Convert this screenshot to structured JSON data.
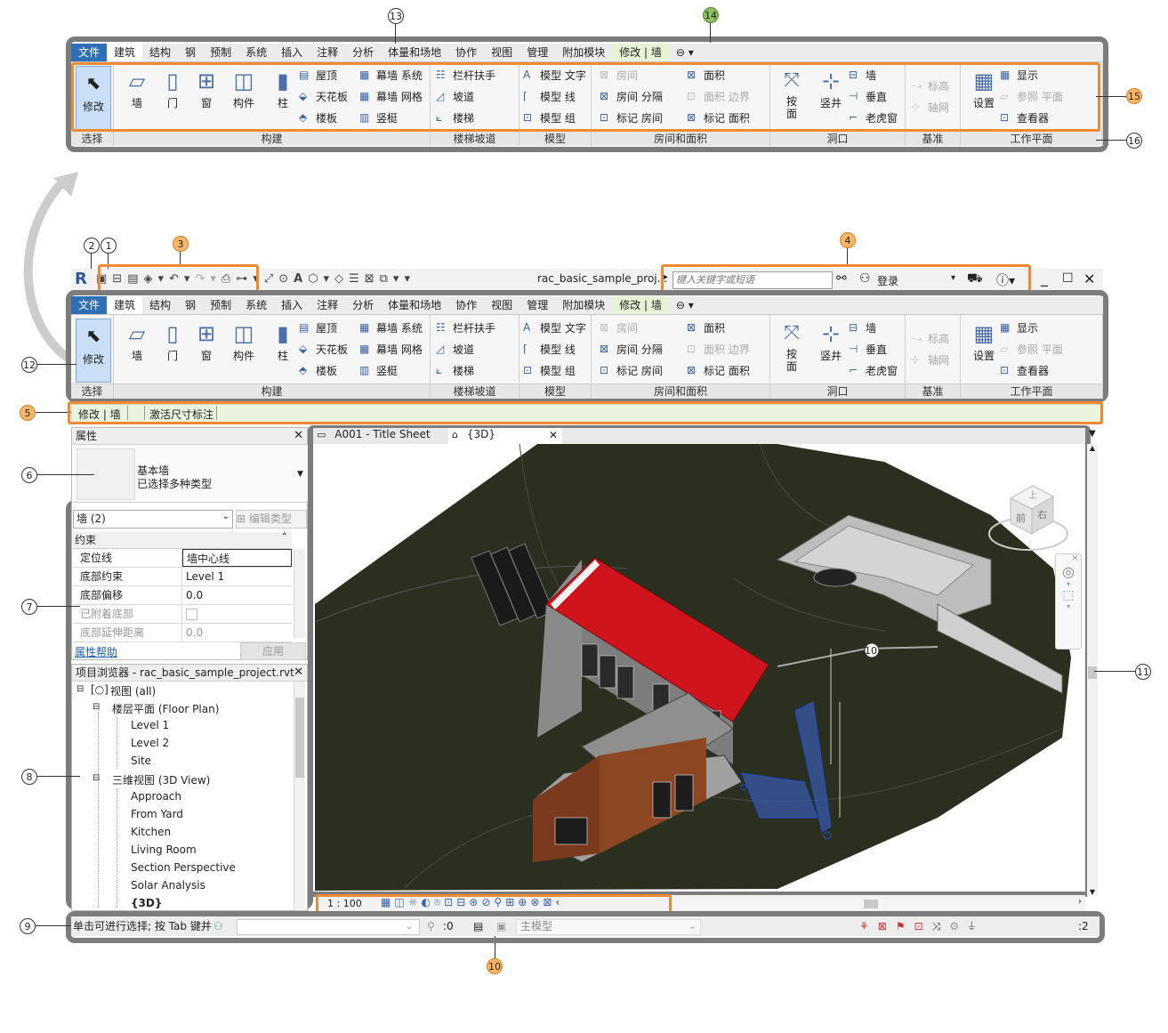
{
  "ribbon": {
    "tabs": [
      "文件",
      "建筑",
      "结构",
      "钢",
      "预制",
      "系统",
      "插入",
      "注释",
      "分析",
      "体量和场地",
      "协作",
      "视图",
      "管理",
      "附加模块",
      "修改 | 墙"
    ],
    "extra_tab_icon": "ribbon-toggle-icon",
    "modify_label": "修改",
    "select_label": "选择",
    "build": {
      "wall": "墙",
      "door": "门",
      "window": "窗",
      "component": "构件",
      "column": "柱",
      "roof": "屋顶",
      "ceiling": "天花板",
      "floor": "楼板",
      "curtain_system": "幕墙 系统",
      "curtain_grid": "幕墙 网格",
      "mullion": "竖梃",
      "label": "构建"
    },
    "stairs": {
      "railing": "栏杆扶手",
      "ramp": "坡道",
      "stair": "楼梯",
      "label": "楼梯坡道"
    },
    "model": {
      "text": "模型 文字",
      "line": "模型 线",
      "group": "模型 组",
      "label": "模型"
    },
    "room": {
      "room": "房间",
      "separator": "房间 分隔",
      "tag_room": "标记 房间",
      "area": "面积",
      "area_boundary": "面积 边界",
      "tag_area": "标记 面积",
      "label": "房间和面积"
    },
    "opening": {
      "by_face": "按面",
      "shaft": "竖井",
      "wall": "墙",
      "vertical": "垂直",
      "dormer": "老虎窗",
      "label": "洞口"
    },
    "datum": {
      "level": "标高",
      "grid": "轴网",
      "label": "基准"
    },
    "workplane": {
      "set": "设置",
      "show": "显示",
      "ref_plane": "参照 平面",
      "viewer": "查看器",
      "label": "工作平面"
    }
  },
  "titlebar": {
    "logo": "R",
    "filename": "rac_basic_sample_proj...",
    "search_placeholder": "键入关键字或短语",
    "login": "登录"
  },
  "options_bar": {
    "context": "修改 | 墙",
    "activate_dims": "激活尺寸标注"
  },
  "properties": {
    "title": "属性",
    "type_name": "基本墙",
    "type_sub": "已选择多种类型",
    "selector": "墙 (2)",
    "edit_type": "编辑类型",
    "section": "约束",
    "rows": [
      {
        "k": "定位线",
        "v": "墙中心线"
      },
      {
        "k": "底部约束",
        "v": "Level 1"
      },
      {
        "k": "底部偏移",
        "v": "0.0"
      },
      {
        "k": "已附着底部",
        "v": ""
      },
      {
        "k": "底部延伸距离",
        "v": "0.0"
      }
    ],
    "help": "属性帮助",
    "apply": "应用"
  },
  "browser": {
    "title": "项目浏览器 - rac_basic_sample_project.rvt",
    "views": "视图 (all)",
    "floor_plan": "楼层平面 (Floor Plan)",
    "plans": [
      "Level 1",
      "Level 2",
      "Site"
    ],
    "three_d": "三维视图 (3D View)",
    "views3d": [
      "Approach",
      "From Yard",
      "Kitchen",
      "Living Room",
      "Section Perspective",
      "Solar Analysis",
      "{3D}"
    ]
  },
  "view_tabs": {
    "sheet": "A001 - Title Sheet",
    "three_d": "{3D}"
  },
  "viewcube": {
    "front": "前",
    "right": "右",
    "top": "上"
  },
  "view_control": {
    "scale": "1 : 100"
  },
  "statusbar": {
    "message": "单击可进行选择; 按 Tab 键并",
    "worksets": ":0",
    "model": "主模型",
    "filter_count": ":2"
  },
  "callouts": [
    "1",
    "2",
    "3",
    "4",
    "5",
    "6",
    "7",
    "8",
    "9",
    "10",
    "11",
    "12",
    "13",
    "14",
    "15",
    "16"
  ],
  "colors": {
    "orange": "#ee8a33",
    "frame_gray": "#7c7c7c",
    "file_blue": "#2f6fb5",
    "ctx_green": "#e8f3d6"
  }
}
